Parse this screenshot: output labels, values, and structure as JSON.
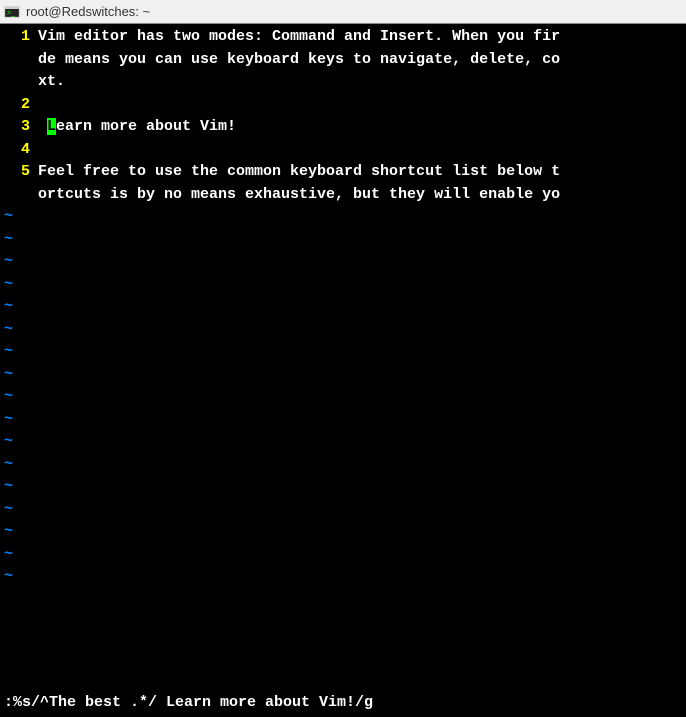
{
  "window": {
    "title": "root@Redswitches: ~"
  },
  "editor": {
    "lines": [
      {
        "num": "1",
        "text": "Vim editor has two modes: Command and Insert. When you fir"
      },
      {
        "num": " ",
        "text": "de means you can use keyboard keys to navigate, delete, co"
      },
      {
        "num": " ",
        "text": "xt."
      },
      {
        "num": "2",
        "text": ""
      },
      {
        "num": "3",
        "text": " ",
        "cursor": "L",
        "after": "earn more about Vim!"
      },
      {
        "num": "4",
        "text": ""
      },
      {
        "num": "5",
        "text": "Feel free to use the common keyboard shortcut list below t"
      },
      {
        "num": " ",
        "text": "ortcuts is by no means exhaustive, but they will enable yo"
      }
    ],
    "tilde": "~",
    "tilde_count": 17
  },
  "command": ":%s/^The best .*/ Learn more about Vim!/g"
}
